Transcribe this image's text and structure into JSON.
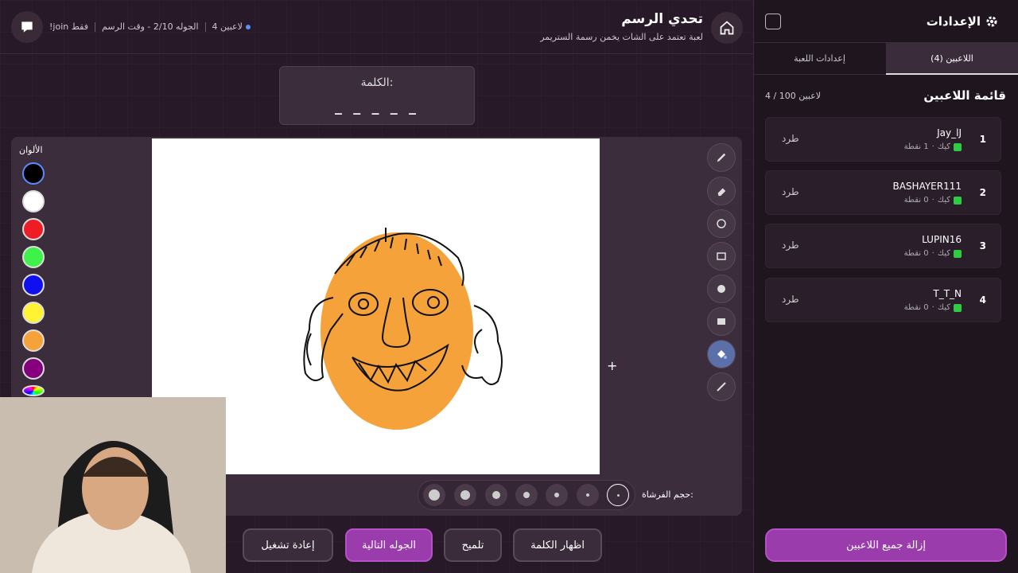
{
  "header": {
    "title": "تحدي الرسم",
    "subtitle": "لعبة تعتمد على الشات يخمن رسمة الستريمر",
    "players_count": "4 لاعبين",
    "round": "الجوله 2/10 - وقت الرسم",
    "join_hint": "!join فقط"
  },
  "word": {
    "label": "الكلمة:",
    "blanks": "_ _ _ _ _"
  },
  "colors": {
    "label": "الألوان",
    "swatches": [
      "#000000",
      "#ffffff",
      "#ee1c24",
      "#3ef24a",
      "#1010ee",
      "#fff334",
      "#f5a23a",
      "#84007d"
    ]
  },
  "tools": [
    "brush-icon",
    "eraser-icon",
    "circle-outline-icon",
    "rect-outline-icon",
    "circle-fill-icon",
    "rect-fill-icon",
    "fill-bucket-icon",
    "line-icon"
  ],
  "brush": {
    "label": "حجم الفرشاة:"
  },
  "buttons": {
    "restart": "إعادة تشغيل",
    "next_round": "الجوله التالية",
    "hint": "تلميح",
    "show_word": "اظهار الكلمة"
  },
  "sidebar": {
    "title": "الإعدادات",
    "tab_players": "اللاعبين (4)",
    "tab_settings": "إعدادات اللعبة",
    "list_title": "قائمة اللاعبين",
    "list_count": "4 / 100 لاعبين",
    "kick_label": "كيك",
    "remove_label": "طرد",
    "remove_all": "إزالة جميع اللاعبين",
    "players": [
      {
        "rank": "1",
        "name": "Jay_lJ",
        "points": "1 نقطة"
      },
      {
        "rank": "2",
        "name": "BASHAYER111",
        "points": "0 نقطة"
      },
      {
        "rank": "3",
        "name": "LUPIN16",
        "points": "0 نقطة"
      },
      {
        "rank": "4",
        "name": "T_T_N",
        "points": "0 نقطة"
      }
    ]
  },
  "accent": "#9a3cab"
}
